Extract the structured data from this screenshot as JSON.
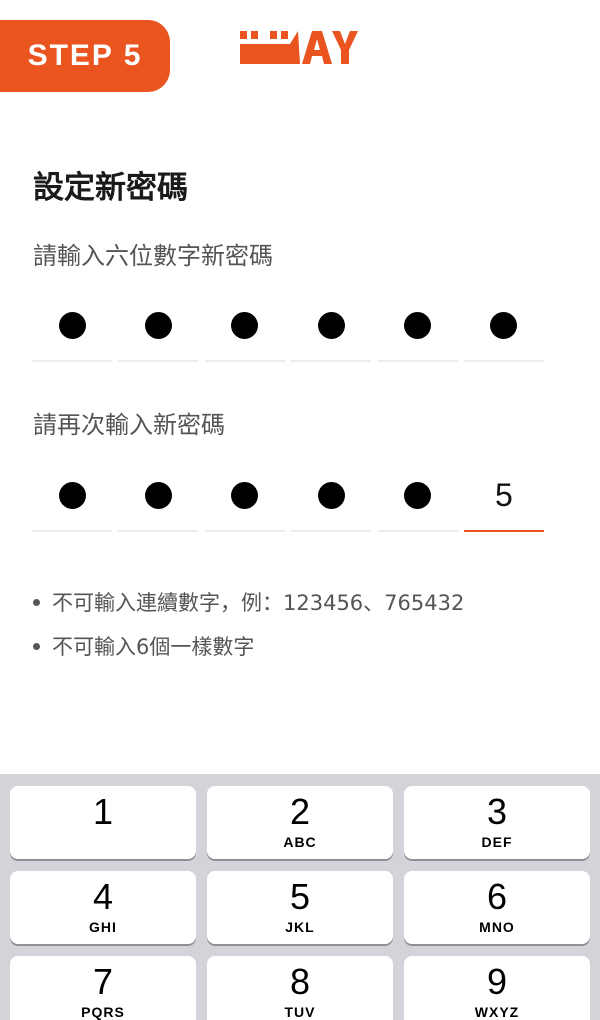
{
  "header": {
    "step_label": "STEP 5",
    "logo_text": "UUAY",
    "brand_color": "#e9541f"
  },
  "form": {
    "title": "設定新密碼",
    "new_password_label": "請輸入六位數字新密碼",
    "confirm_password_label": "請再次輸入新密碼",
    "new_password_filled": 6,
    "confirm_password_masked": 5,
    "confirm_last_digit": "5"
  },
  "rules": [
    "不可輸入連續數字，例：123456、765432",
    "不可輸入6個一樣數字"
  ],
  "keyboard": {
    "keys": [
      {
        "num": "1",
        "letters": ""
      },
      {
        "num": "2",
        "letters": "ABC"
      },
      {
        "num": "3",
        "letters": "DEF"
      },
      {
        "num": "4",
        "letters": "GHI"
      },
      {
        "num": "5",
        "letters": "JKL"
      },
      {
        "num": "6",
        "letters": "MNO"
      },
      {
        "num": "7",
        "letters": "PQRS"
      },
      {
        "num": "8",
        "letters": "TUV"
      },
      {
        "num": "9",
        "letters": "WXYZ"
      }
    ]
  }
}
